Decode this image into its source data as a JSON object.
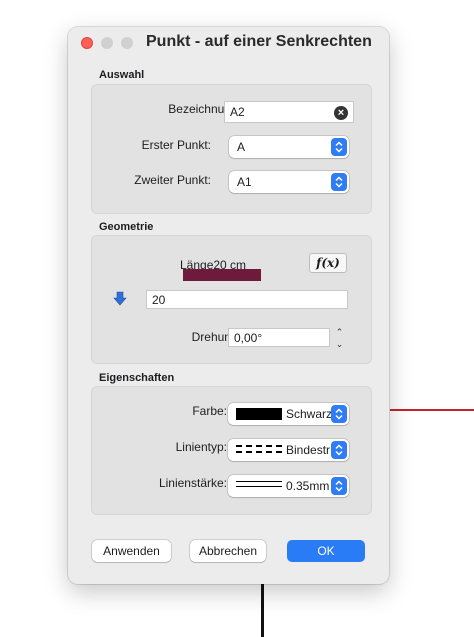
{
  "dialog": {
    "title": "Punkt - auf einer Senkrechten"
  },
  "auswahl": {
    "section_title": "Auswahl",
    "bezeichnung_label": "Bezeichnung:",
    "bezeichnung_value": "A2",
    "erster_punkt_label": "Erster Punkt:",
    "erster_punkt_value": "A",
    "zweiter_punkt_label": "Zweiter Punkt:",
    "zweiter_punkt_value": "A1"
  },
  "geometrie": {
    "section_title": "Geometrie",
    "laenge_label": "Länge",
    "laenge_value": "20 cm",
    "fx_label": "f(x)",
    "input_value": "20",
    "drehung_label": "Drehung:",
    "drehung_value": "0,00°"
  },
  "eigenschaften": {
    "section_title": "Eigenschaften",
    "farbe_label": "Farbe:",
    "farbe_value": "Schwarz",
    "farbe_color": "#000000",
    "linientyp_label": "Linientyp:",
    "linientyp_value": "Bindestr",
    "linienstaerke_label": "Linienstärke:",
    "linienstaerke_value": "0.35mm"
  },
  "buttons": {
    "anwenden": "Anwenden",
    "abbrechen": "Abbrechen",
    "ok": "OK"
  },
  "colors": {
    "accent": "#2a7cf6",
    "redaction": "#6e1a3d",
    "background_line": "#cc1f2d"
  }
}
